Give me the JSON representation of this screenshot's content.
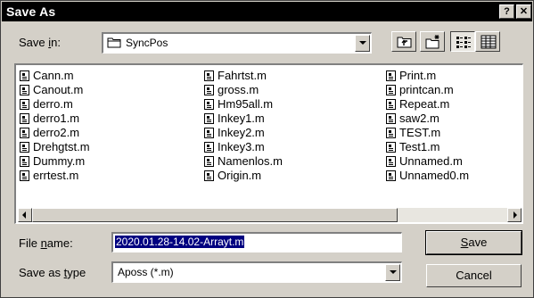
{
  "window": {
    "title": "Save As",
    "help_label": "?",
    "close_label": "✕"
  },
  "save_in": {
    "label_prefix": "Save ",
    "label_access": "i",
    "label_suffix": "n:",
    "value": "SyncPos"
  },
  "toolbar": {
    "icons": [
      "up-one-level-icon",
      "create-new-folder-icon",
      "list-view-icon",
      "details-view-icon"
    ],
    "pressed": "list-view-icon"
  },
  "files": {
    "columns": [
      [
        "Cann.m",
        "Canout.m",
        "derro.m",
        "derro1.m",
        "derro2.m",
        "Drehgtst.m",
        "Dummy.m",
        "errtest.m"
      ],
      [
        "Fahrtst.m",
        "gross.m",
        "Hm95all.m",
        "Inkey1.m",
        "Inkey2.m",
        "Inkey3.m",
        "Namenlos.m",
        "Origin.m"
      ],
      [
        "Print.m",
        "printcan.m",
        "Repeat.m",
        "saw2.m",
        "TEST.m",
        "Test1.m",
        "Unnamed.m",
        "Unnamed0.m"
      ]
    ]
  },
  "file_name": {
    "label_prefix": "File ",
    "label_access": "n",
    "label_suffix": "ame:",
    "value": "2020.01.28-14.02-Arrayt.m"
  },
  "save_type": {
    "label_prefix": "Save as ",
    "label_access": "t",
    "label_suffix": "ype",
    "value": "Aposs (*.m)"
  },
  "buttons": {
    "save_access": "S",
    "save_rest": "ave",
    "cancel": "Cancel"
  }
}
